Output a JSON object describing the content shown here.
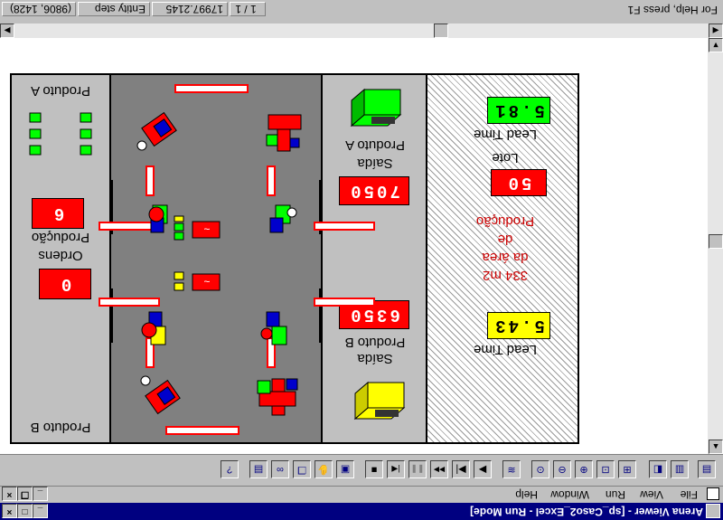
{
  "window": {
    "title": "Arena Viewer - [sp_Caso2_Excel - Run Mode]"
  },
  "menu": {
    "items": [
      {
        "label": "File"
      },
      {
        "label": "View"
      },
      {
        "label": "Run"
      },
      {
        "label": "Window"
      },
      {
        "label": "Help"
      }
    ]
  },
  "toolbar": {
    "buttons": [
      {
        "icon": "open-icon",
        "glyph": "▤"
      },
      {
        "icon": "print-icon",
        "glyph": "▥"
      },
      {
        "icon": "print-preview-icon",
        "glyph": "◧"
      },
      {
        "icon": "zoom-fit-icon",
        "glyph": "⊞"
      },
      {
        "icon": "zoom-box-icon",
        "glyph": "⊡"
      },
      {
        "icon": "zoom-in-icon",
        "glyph": "⊕"
      },
      {
        "icon": "zoom-out-icon",
        "glyph": "⊖"
      },
      {
        "icon": "zoom-actual-icon",
        "glyph": "⊙"
      },
      {
        "icon": "layers-icon",
        "glyph": "≋"
      },
      {
        "icon": "go-icon",
        "glyph": "▶"
      },
      {
        "icon": "step-icon",
        "glyph": "▶|"
      },
      {
        "icon": "fast-forward-icon",
        "glyph": "▶▶"
      },
      {
        "icon": "pause-icon",
        "glyph": "❚❚"
      },
      {
        "icon": "start-over-icon",
        "glyph": "|◀"
      },
      {
        "icon": "end-icon",
        "glyph": "■"
      },
      {
        "icon": "views-icon",
        "glyph": "▣"
      },
      {
        "icon": "hand-icon",
        "glyph": "✋"
      },
      {
        "icon": "windows-icon",
        "glyph": "❐"
      },
      {
        "icon": "binoculars-icon",
        "glyph": "∞"
      },
      {
        "icon": "report-icon",
        "glyph": "▤"
      },
      {
        "icon": "help-pointer-icon",
        "glyph": "?"
      }
    ]
  },
  "status": {
    "help": "For Help, press F1",
    "page": "1 / 1",
    "time": "17997.2145",
    "mode": "Entity step",
    "coords": "(9806, 1428)"
  },
  "sim": {
    "left_panel": {
      "product_a_label": "Produto A",
      "orders_label_1": "Ordens",
      "orders_label_2": "Produção",
      "orders_value": "0",
      "production_value": "6",
      "product_b_label": "Produto B"
    },
    "exit_panel": {
      "exit_a_label_1": "Saída",
      "exit_a_label_2": "Produto A",
      "exit_a_value": "7050",
      "exit_b_label_1": "Saída",
      "exit_b_label_2": "Produto B",
      "exit_b_value": "6350"
    },
    "right_panel": {
      "lead_time_a_label": "Lead Time",
      "lead_time_a_value": "5.81",
      "lot_label": "Lote",
      "lot_value": "50",
      "area_line_1": "Produção",
      "area_line_2": "de",
      "area_line_3": "da área",
      "area_line_4": "334 m2",
      "lead_time_b_label": "Lead Time",
      "lead_time_b_value": "5.43"
    }
  },
  "colors": {
    "accent": "#ff0000",
    "green": "#00ff00",
    "yellow": "#ffff00",
    "blue": "#0000cc",
    "floor": "#808080",
    "panel": "#c0c0c0",
    "title_bar": "#000080"
  }
}
